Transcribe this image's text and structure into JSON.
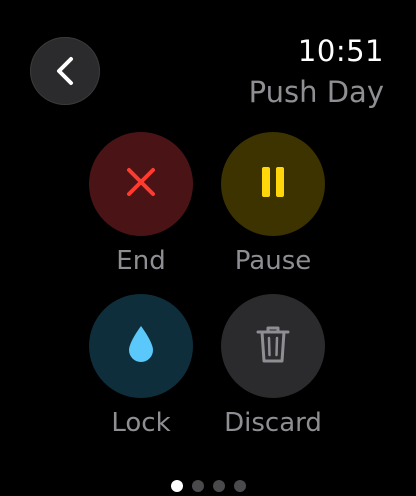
{
  "status": {
    "time": "10:51",
    "workout_title": "Push Day"
  },
  "navigation": {
    "back_icon": "chevron-left-icon"
  },
  "actions": [
    {
      "id": "end",
      "label": "End",
      "icon": "x-mark-icon",
      "bg_color": "#4a1416",
      "icon_color": "#ff3b30"
    },
    {
      "id": "pause",
      "label": "Pause",
      "icon": "pause-icon",
      "bg_color": "#3d3300",
      "icon_color": "#ffd60a"
    },
    {
      "id": "lock",
      "label": "Lock",
      "icon": "water-drop-icon",
      "bg_color": "#0f2e3b",
      "icon_color": "#5ac8fa"
    },
    {
      "id": "discard",
      "label": "Discard",
      "icon": "trash-icon",
      "bg_color": "#2b2b2d",
      "icon_color": "#8e8e93"
    }
  ],
  "pager": {
    "page_count": 4,
    "current_page": 1
  }
}
